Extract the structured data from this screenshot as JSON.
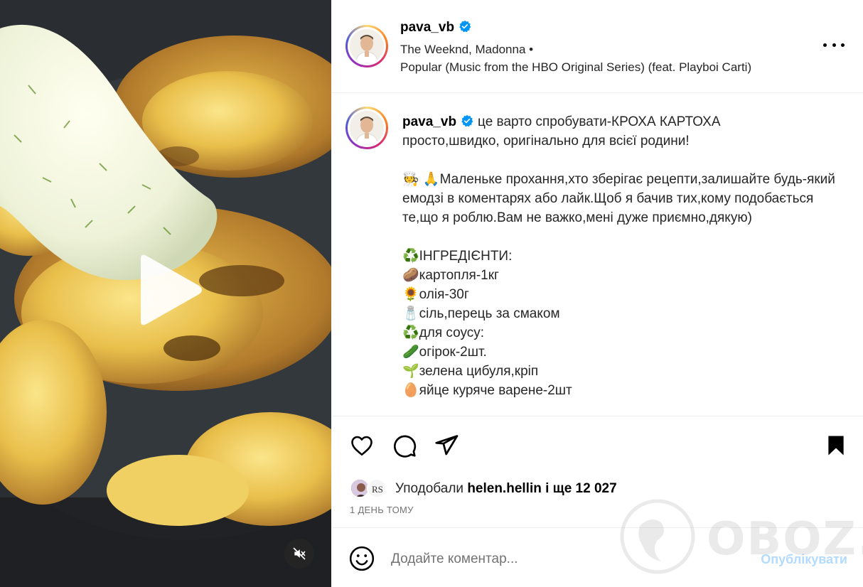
{
  "post": {
    "username": "pava_vb",
    "music_artists": "The Weeknd, Madonna •",
    "music_track": "Popular (Music from the HBO Original Series) (feat. Playboi Carti)"
  },
  "caption": {
    "username": "pava_vb",
    "line1": "це варто спробувати-КРОХА КАРТОХА",
    "line2": "просто,швидко, оригінально для всієї родини!",
    "para2": "🧑‍🍳 🙏Маленьке прохання,хто зберігає рецепти,залишайте будь-який емодзі в коментарях або лайк.Щоб я бачив тих,кому подобається те,що я роблю.Вам не важко,мені дуже приємно,дякую)",
    "items": [
      "♻️ІНГРЕДІЄНТИ:",
      "🥔картопля-1кг",
      "🌻олія-30г",
      "🧂сіль,перець за смаком",
      "♻️для соусу:",
      "🥒огірок-2шт.",
      "🌱зелена цибуля,кріп",
      "🥚яйце куряче варене-2шт"
    ]
  },
  "likes": {
    "prefix": "Уподобали",
    "user": "helen.hellin",
    "suffix": "і ще 12 027"
  },
  "timestamp": "1 ДЕНЬ ТОМУ",
  "comment": {
    "placeholder": "Додайте коментар...",
    "publish": "Опублікувати"
  },
  "watermark": "OBOZ.UA",
  "icons": {
    "verified": "verified-badge-icon",
    "play": "play-icon",
    "mute": "speaker-muted-icon",
    "more": "more-options-icon",
    "like": "heart-icon",
    "comment": "comment-bubble-icon",
    "share": "paper-plane-icon",
    "save": "bookmark-icon",
    "emoji": "smiley-icon"
  },
  "colors": {
    "verified": "#0095f6",
    "publish_disabled": "#b3dbff",
    "secondary_text": "#737373"
  }
}
